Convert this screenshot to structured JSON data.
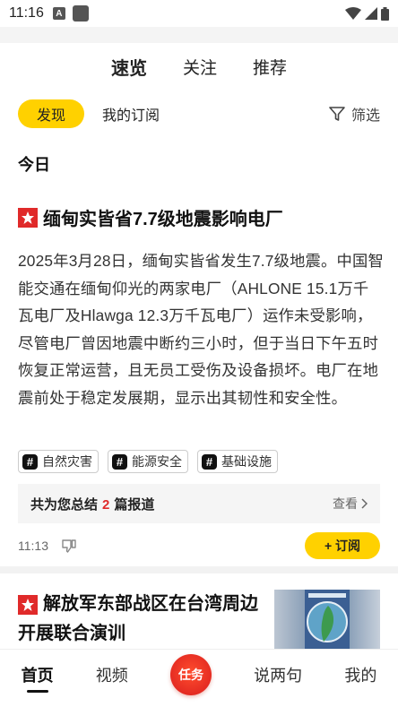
{
  "status_bar": {
    "time": "11:16",
    "notification_letter": "A"
  },
  "top_tabs": [
    {
      "label": "速览",
      "active": true
    },
    {
      "label": "关注",
      "active": false
    },
    {
      "label": "推荐",
      "active": false
    }
  ],
  "filter_row": {
    "discover_label": "发现",
    "subscriptions_label": "我的订阅",
    "filter_label": "筛选"
  },
  "section_title": "今日",
  "article": {
    "title": "缅甸实皆省7.7级地震影响电厂",
    "body": "2025年3月28日，缅甸实皆省发生7.7级地震。中国智能交通在缅甸仰光的两家电厂（AHLONE 15.1万千瓦电厂及Hlawga 12.3万千瓦电厂）运作未受影响，尽管电厂曾因地震中断约三小时，但于当日下午五时恢复正常运营，且无员工受伤及设备损坏。电厂在地震前处于稳定发展期，显示出其韧性和安全性。",
    "tags": [
      {
        "hash": "#",
        "label": "自然灾害"
      },
      {
        "hash": "#",
        "label": "能源安全"
      },
      {
        "hash": "#",
        "label": "基础设施"
      }
    ],
    "summary_prefix": "共为您总结",
    "summary_count": "2",
    "summary_suffix": "篇报道",
    "view_label": "查看",
    "time": "11:13",
    "subscribe_label": "+ 订阅"
  },
  "article2": {
    "title": "解放军东部战区在台湾周边开展联合演训"
  },
  "bottom_nav": [
    {
      "label": "首页",
      "active": true
    },
    {
      "label": "视频",
      "active": false
    },
    {
      "label": "任务",
      "active": false
    },
    {
      "label": "说两句",
      "active": false
    },
    {
      "label": "我的",
      "active": false
    }
  ],
  "colors": {
    "accent_yellow": "#ffd100",
    "badge_red": "#e02a2a",
    "task_red": "#d91d1d"
  }
}
